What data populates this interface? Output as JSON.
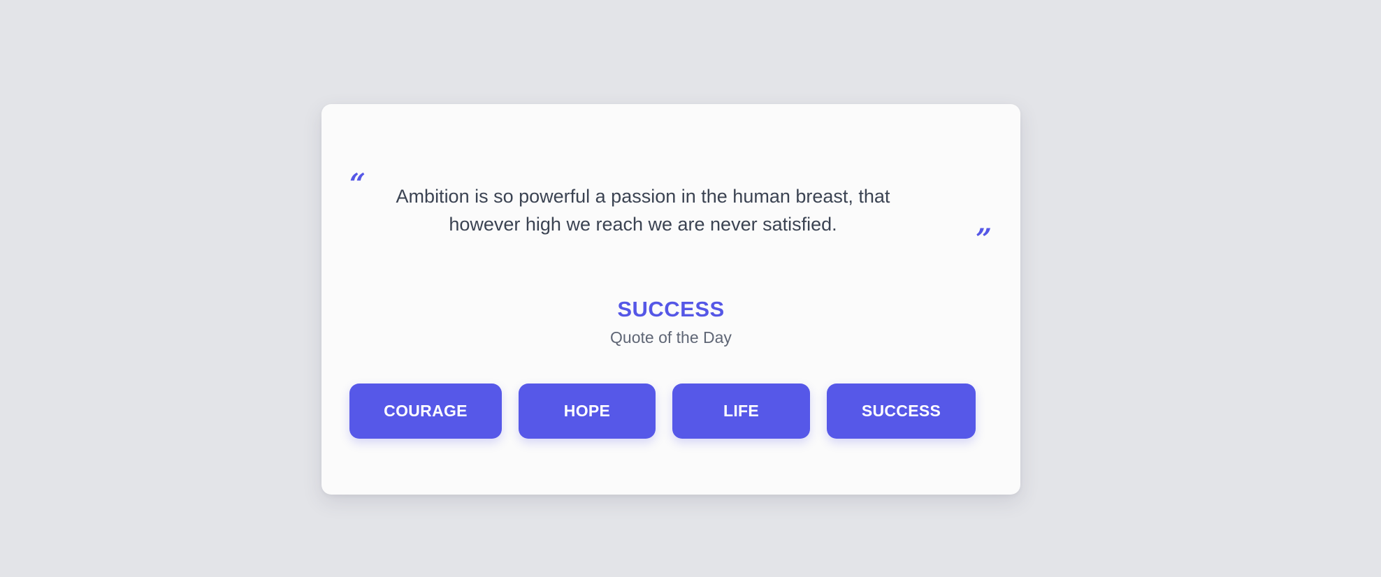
{
  "quote": {
    "open_mark": "“",
    "close_mark": "”",
    "text": "Ambition is so powerful a passion in the human breast, that however high we reach we are never satisfied."
  },
  "category": {
    "title": "SUCCESS",
    "subtitle": "Quote of the Day"
  },
  "buttons": [
    {
      "label": "COURAGE"
    },
    {
      "label": "HOPE"
    },
    {
      "label": "LIFE"
    },
    {
      "label": "SUCCESS"
    }
  ],
  "colors": {
    "accent": "#5557e6",
    "background": "#e3e4e8",
    "card": "#fbfbfb",
    "text": "#3b4352",
    "muted": "#5f6675"
  }
}
